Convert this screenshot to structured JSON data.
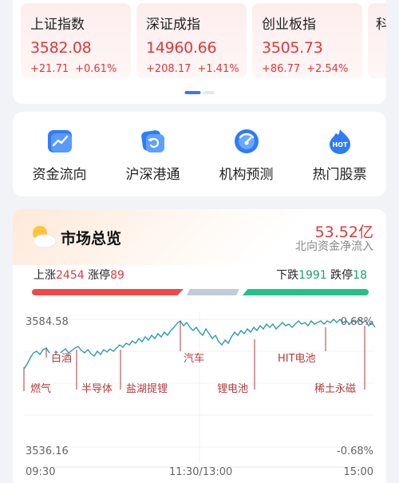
{
  "indices": [
    {
      "name": "上证指数",
      "value": "3582.08",
      "change": "+21.71",
      "pct": "+0.61%"
    },
    {
      "name": "深证成指",
      "value": "14960.66",
      "change": "+208.17",
      "pct": "+1.41%"
    },
    {
      "name": "创业板指",
      "value": "3505.73",
      "change": "+86.77",
      "pct": "+2.54%"
    },
    {
      "name": "科"
    }
  ],
  "nav": [
    {
      "label": "资金流向",
      "icon": "trend-chart-icon"
    },
    {
      "label": "沪深港通",
      "icon": "hk-connect-icon"
    },
    {
      "label": "机构预测",
      "icon": "gauge-icon"
    },
    {
      "label": "热门股票",
      "icon": "hot-fire-icon"
    }
  ],
  "market": {
    "title": "市场总览",
    "flow_value": "53.52亿",
    "flow_label": "北向资金净流入",
    "up_label": "上涨",
    "up_count": "2454",
    "limit_up_label": "涨停",
    "limit_up_count": "89",
    "down_label": "下跌",
    "down_count": "1991",
    "limit_down_label": "跌停",
    "limit_down_count": "18",
    "y_high": "3584.58",
    "y_low": "3536.16",
    "pct_high": "0.68%",
    "pct_low": "-0.68%",
    "time_start": "09:30",
    "time_mid": "11:30/13:00",
    "time_end": "15:00",
    "tags": [
      "白酒",
      "燃气",
      "半导体",
      "盐湖提锂",
      "汽车",
      "锂电池",
      "HIT电池",
      "稀土永磁"
    ]
  },
  "colors": {
    "up": "#e0383b",
    "down": "#16a36b",
    "line": "#2e9ca6",
    "accent": "#3b77f0"
  }
}
